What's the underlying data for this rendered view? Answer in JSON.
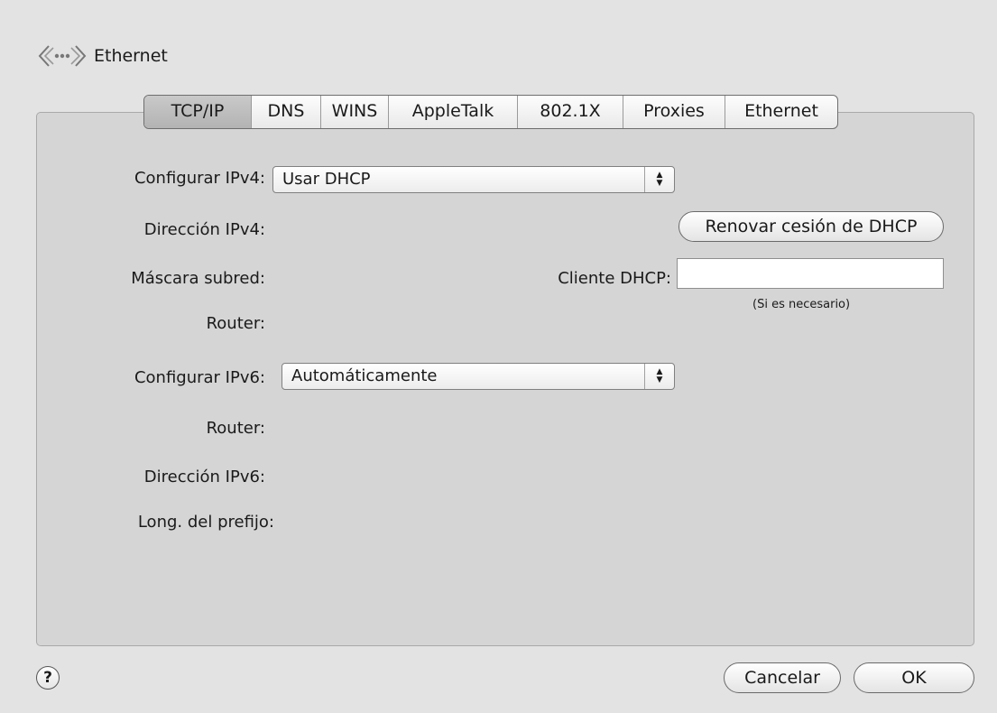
{
  "window": {
    "title": "Ethernet"
  },
  "icons": {
    "header": "ethernet-network-icon",
    "help": "help-icon"
  },
  "tabs": [
    {
      "label": "TCP/IP",
      "selected": true
    },
    {
      "label": "DNS",
      "selected": false
    },
    {
      "label": "WINS",
      "selected": false
    },
    {
      "label": "AppleTalk",
      "selected": false
    },
    {
      "label": "802.1X",
      "selected": false
    },
    {
      "label": "Proxies",
      "selected": false
    },
    {
      "label": "Ethernet",
      "selected": false
    }
  ],
  "ipv4": {
    "configure_label": "Configurar IPv4:",
    "configure_value": "Usar DHCP",
    "address_label": "Dirección IPv4:",
    "subnet_label": "Máscara subred:",
    "router_label": "Router:",
    "renew_button": "Renovar cesión de DHCP",
    "dhcp_client_label": "Cliente DHCP:",
    "dhcp_client_value": "",
    "dhcp_client_hint": "(Si es necesario)"
  },
  "ipv6": {
    "configure_label": "Configurar IPv6:",
    "configure_value": "Automáticamente",
    "router_label": "Router:",
    "address_label": "Dirección IPv6:",
    "prefix_label": "Long. del prefijo:"
  },
  "footer": {
    "help_label": "?",
    "cancel_button": "Cancelar",
    "ok_button": "OK"
  },
  "popup_arrow_up": "▲",
  "popup_arrow_down": "▼"
}
